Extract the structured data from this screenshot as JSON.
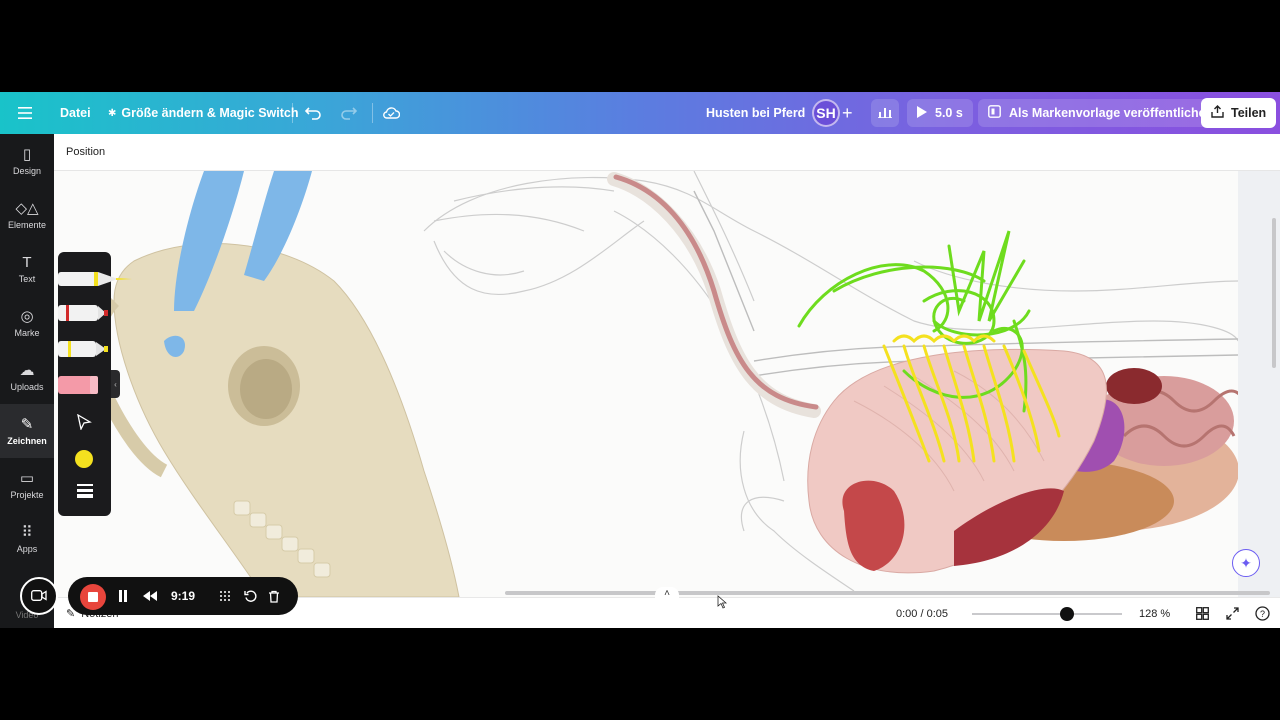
{
  "topbar": {
    "menu_label": "Datei",
    "resize_label": "Größe ändern & Magic Switch",
    "design_title": "Husten bei Pferd",
    "avatar_initials": "SH",
    "play_duration": "5.0 s",
    "brand_template_label": "Als Markenvorlage veröffentlichen",
    "share_label": "Teilen"
  },
  "sidebar": {
    "items": [
      {
        "label": "Design",
        "icon": "design-icon"
      },
      {
        "label": "Elemente",
        "icon": "elements-icon"
      },
      {
        "label": "Text",
        "icon": "text-icon"
      },
      {
        "label": "Marke",
        "icon": "brand-icon"
      },
      {
        "label": "Uploads",
        "icon": "upload-icon"
      },
      {
        "label": "Zeichnen",
        "icon": "draw-icon"
      },
      {
        "label": "Projekte",
        "icon": "folder-icon"
      },
      {
        "label": "Apps",
        "icon": "apps-icon"
      },
      {
        "label": "Video",
        "icon": "video-icon"
      }
    ],
    "active": "Zeichnen"
  },
  "position_bar": {
    "label": "Position"
  },
  "draw_tools": {
    "tools": [
      "pen",
      "marker",
      "highlighter",
      "eraser",
      "select"
    ],
    "current_color": "#f4e11f"
  },
  "bottombar": {
    "notes_label": "Notizen",
    "time": "0:00 / 0:05",
    "zoom": "128 %",
    "zoom_level": 0.63
  },
  "recorder": {
    "elapsed": "9:19"
  },
  "colors": {
    "accent": "#7b5fe0",
    "record": "#e8453c",
    "drawing_yellow": "#f4e11f",
    "drawing_green": "#6edc1e"
  }
}
